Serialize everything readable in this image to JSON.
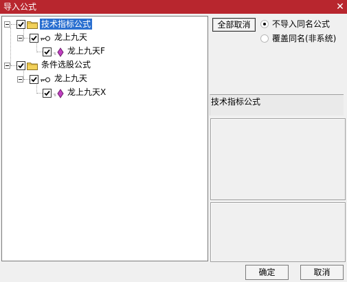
{
  "window": {
    "title": "导入公式",
    "close_glyph": "✕"
  },
  "tree": {
    "nodes": [
      {
        "label": "技术指标公式",
        "checked": true,
        "icon": "folder-icon",
        "selected": true
      },
      {
        "label": "龙上九天",
        "checked": true,
        "icon": "key-icon"
      },
      {
        "label": "龙上九天F",
        "checked": true,
        "icon": "gem-icon"
      },
      {
        "label": "条件选股公式",
        "checked": true,
        "icon": "folder-icon"
      },
      {
        "label": "龙上九天",
        "checked": true,
        "icon": "key-icon"
      },
      {
        "label": "龙上九天X",
        "checked": true,
        "icon": "gem-icon"
      }
    ]
  },
  "side": {
    "deselect_all": "全部取消",
    "options": [
      {
        "label": "不导入同名公式",
        "selected": true
      },
      {
        "label": "覆盖同名(非系统)",
        "selected": false
      }
    ],
    "info_label": "技术指标公式"
  },
  "footer": {
    "ok": "确定",
    "cancel": "取消"
  },
  "colors": {
    "titlebar": "#b8262e",
    "selection": "#2a6fd0",
    "folder": "#f2d15a",
    "gem": "#c040c0"
  }
}
